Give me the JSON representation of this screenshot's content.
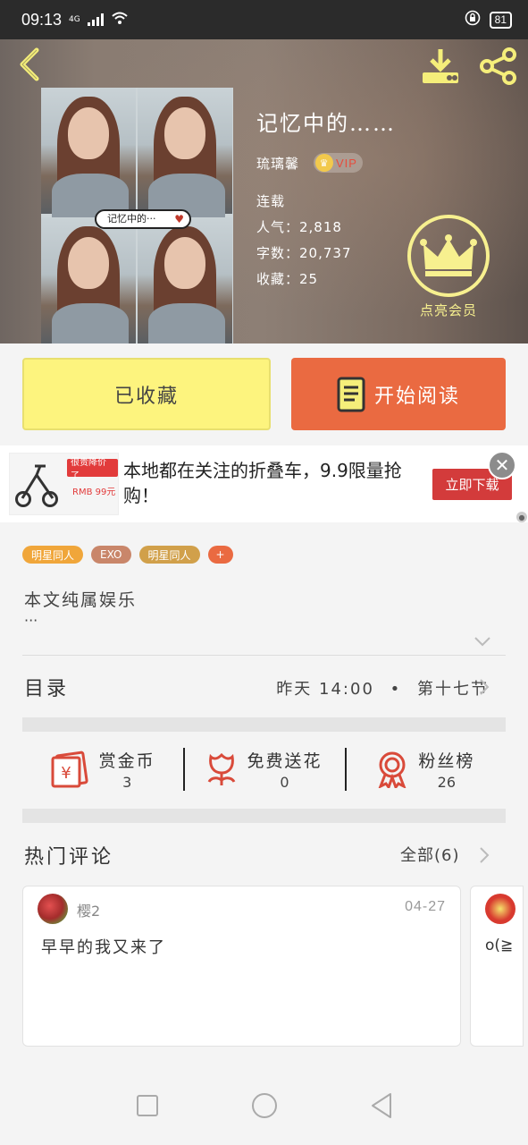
{
  "status_bar": {
    "time": "09:13",
    "network": "4G",
    "battery": "81"
  },
  "book": {
    "title": "记忆中的……",
    "author": "琉璃馨",
    "vip_badge": "VIP",
    "status": "连载",
    "popularity": "人气：2,818",
    "word_count": "字数：20,737",
    "favorites": "收藏：25",
    "cover_caption": "记忆中的···"
  },
  "member": {
    "label": "点亮会员"
  },
  "actions": {
    "collected_label": "已收藏",
    "read_label": "开始阅读"
  },
  "ad": {
    "text": "本地都在关注的折叠车，9.9限量抢购！",
    "download_label": "立即下载",
    "image_tag": "很贵降价了",
    "image_price": "RMB 99元"
  },
  "tags": [
    {
      "label": "明星同人",
      "color": "#f0a63a"
    },
    {
      "label": "EXO",
      "color": "#c9866a"
    },
    {
      "label": "明星同人",
      "color": "#d1a04a"
    },
    {
      "label": "+",
      "color": "#ea6a41"
    }
  ],
  "description": {
    "text": "本文纯属娱乐",
    "ellipsis": "···"
  },
  "toc": {
    "title": "目录",
    "update_time": "昨天 14:00",
    "separator": "•",
    "latest_chapter": "第十七节"
  },
  "rewards": [
    {
      "label": "赏金币",
      "value": "3",
      "icon": "coin-envelope-icon"
    },
    {
      "label": "免费送花",
      "value": "0",
      "icon": "flower-icon"
    },
    {
      "label": "粉丝榜",
      "value": "26",
      "icon": "medal-icon"
    }
  ],
  "comments": {
    "title": "热门评论",
    "all_label": "全部(6)",
    "items": [
      {
        "user": "樱2",
        "date": "04-27",
        "text": "早早的我又来了"
      },
      {
        "user": "",
        "date": "",
        "text": "o(≧"
      }
    ]
  }
}
